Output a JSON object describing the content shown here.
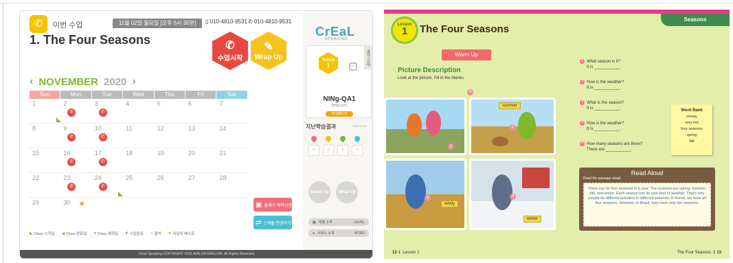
{
  "app": {
    "header": {
      "this_class": "이번 수업",
      "date": "11월 02일 월요일 [오후 5시 30분]",
      "phone1": "010-4810-9531",
      "phone2": "010-4810-9531"
    },
    "lesson_title": "1. The Four Seasons",
    "actions": {
      "start_label": "수업시작",
      "wrapup_label": "Wrap Up"
    },
    "calendar": {
      "month": "NOVEMBER",
      "year": "2020",
      "dow": [
        "Sun",
        "Mon",
        "Tue",
        "Wed",
        "Thu",
        "Fri",
        "Sat"
      ],
      "weeks": [
        [
          "1",
          "2",
          "3",
          "4",
          "5",
          "6",
          "7"
        ],
        [
          "8",
          "9",
          "10",
          "11",
          "12",
          "13",
          "14"
        ],
        [
          "15",
          "16",
          "17",
          "18",
          "19",
          "20",
          "21"
        ],
        [
          "22",
          "23",
          "24",
          "25",
          "26",
          "27",
          "28"
        ],
        [
          "29",
          "30",
          "",
          "",
          "",
          "",
          ""
        ]
      ]
    },
    "side_buttons": {
      "class_reserve": "클래스 예약신청",
      "schedule_change": "스케줄 변경하기"
    },
    "legend": [
      "Class 시작일",
      "Class 종료일",
      "Class 예정일",
      "수업완료",
      "결석",
      "이달의 베스트"
    ],
    "footer": "Creal Speaking COPYRIGHT 2015 AVALON ENGLISH. All Rights Reserved.",
    "right": {
      "logo": "CrEaL",
      "logo_sub": "SPEAKING",
      "level_badge": "Yellow",
      "level_num": "1",
      "vtag": "클래스선택",
      "user": "NINg-QA1",
      "user_sub": "NINg-QA1",
      "mypage": "마이페이지",
      "results_title": "지난학습결과",
      "results_date": "2020.11.10",
      "result_values": [
        "0",
        "0",
        "0",
        "0"
      ],
      "speak_up": "Speak Up",
      "wrap_up": "Wrap Up",
      "level_intro": "레벨 소개",
      "level_intro_en": "LEVEL",
      "service_intro": "서비스 소개",
      "service_intro_en": "INTRO"
    }
  },
  "book": {
    "lesson_label": "Lesson",
    "lesson_num": "1",
    "title": "The Four Seasons",
    "tab": "Seasons",
    "warm_up": "Warm Up",
    "section": "Picture Description",
    "instruction": "Look at the picture. Fill in the blanks.",
    "scene_labels": [
      "summer",
      "windy",
      "winter"
    ],
    "questions": [
      {
        "n": "1",
        "q": "What season is it?",
        "a": "It is ___________."
      },
      {
        "n": "2",
        "q": "How is the weather?",
        "a": "It is ___________."
      },
      {
        "n": "3",
        "q": "What is the season?",
        "a": "It is ___________."
      },
      {
        "n": "4",
        "q": "How is the weather?",
        "a": "It is ___________."
      },
      {
        "n": "5",
        "q": "How many seasons are there?",
        "a": "There are ___________."
      }
    ],
    "word_bank_title": "Word Bank",
    "word_bank": [
      "snowy",
      "very hot",
      "four seasons",
      "spring",
      "fall"
    ],
    "read_aloud_title": "Read Aloud",
    "read_aloud_sub": "Read the passage aloud.",
    "read_aloud_text": "There can be four seasons in a year. The seasons are spring, summer, fall, and winter. Each season has its own kind of weather. That's why people do different activities in different seasons. In Korea, we have all four seasons. However, in Brazil, they have only two seasons.",
    "page_left": "12",
    "page_left_label": "Lesson 1",
    "page_right": "13",
    "page_right_label": "The Four Seasons"
  }
}
